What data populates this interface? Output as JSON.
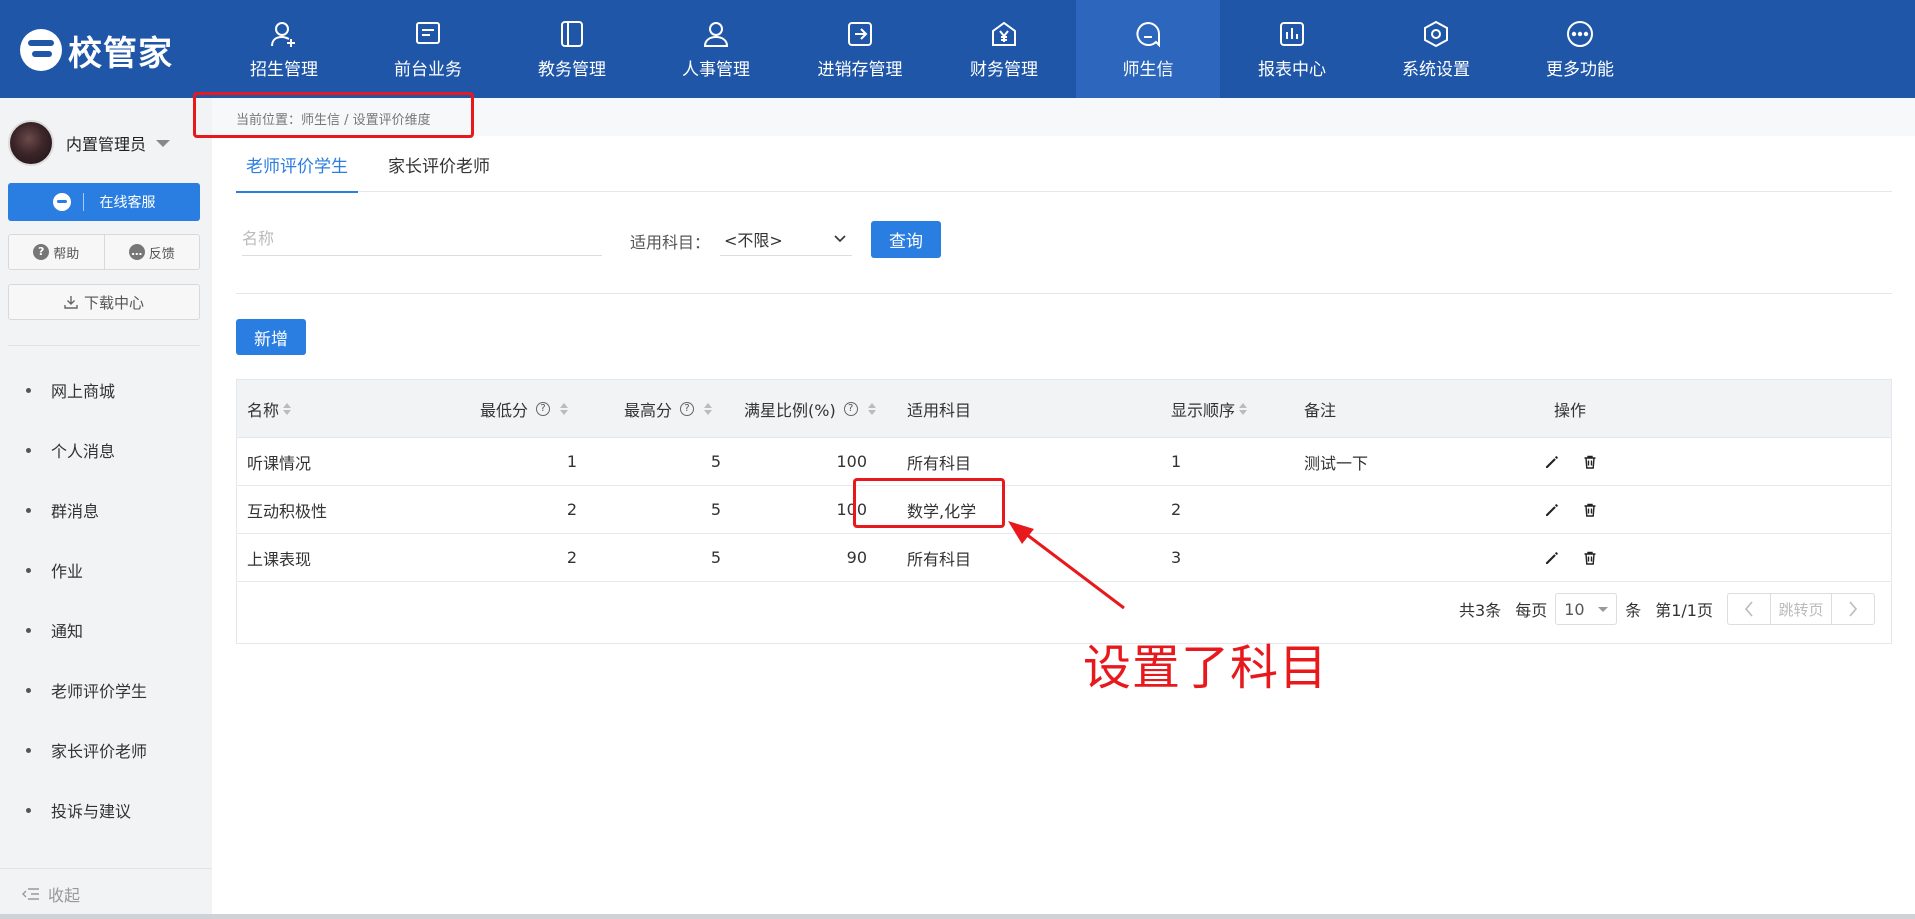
{
  "app": {
    "logo_text": "校管家"
  },
  "nav": {
    "items": [
      {
        "label": "招生管理",
        "icon": "user-plus-icon"
      },
      {
        "label": "前台业务",
        "icon": "message-box-icon"
      },
      {
        "label": "教务管理",
        "icon": "book-icon"
      },
      {
        "label": "人事管理",
        "icon": "person-icon"
      },
      {
        "label": "进销存管理",
        "icon": "arrow-box-icon"
      },
      {
        "label": "财务管理",
        "icon": "yen-house-icon"
      },
      {
        "label": "师生信",
        "icon": "chat-bubble-icon",
        "active": true
      },
      {
        "label": "报表中心",
        "icon": "bar-chart-icon"
      },
      {
        "label": "系统设置",
        "icon": "hexagon-gear-icon"
      },
      {
        "label": "更多功能",
        "icon": "more-dots-icon"
      }
    ]
  },
  "sidebar": {
    "user_name": "内置管理员",
    "service_label": "在线客服",
    "help_label": "帮助",
    "feedback_label": "反馈",
    "download_label": "下载中心",
    "menu": [
      "网上商城",
      "个人消息",
      "群消息",
      "作业",
      "通知",
      "老师评价学生",
      "家长评价老师",
      "投诉与建议"
    ],
    "collapse_label": "收起"
  },
  "breadcrumb": "当前位置：师生信 / 设置评价维度",
  "tabs": [
    {
      "label": "老师评价学生",
      "active": true
    },
    {
      "label": "家长评价老师",
      "active": false
    }
  ],
  "filter": {
    "name_placeholder": "名称",
    "subject_label": "适用科目：",
    "subject_value": "<不限>",
    "query_label": "查询"
  },
  "add_label": "新增",
  "table": {
    "headers": {
      "name": "名称",
      "min": "最低分",
      "max": "最高分",
      "ratio": "满星比例(%)",
      "subject": "适用科目",
      "order": "显示顺序",
      "note": "备注",
      "action": "操作"
    },
    "rows": [
      {
        "name": "听课情况",
        "min": "1",
        "max": "5",
        "ratio": "100",
        "subject": "所有科目",
        "order": "1",
        "note": "测试一下"
      },
      {
        "name": "互动积极性",
        "min": "2",
        "max": "5",
        "ratio": "100",
        "subject": "数学,化学",
        "order": "2",
        "note": ""
      },
      {
        "name": "上课表现",
        "min": "2",
        "max": "5",
        "ratio": "90",
        "subject": "所有科目",
        "order": "3",
        "note": ""
      }
    ]
  },
  "pager": {
    "total": "共3条",
    "per_page_label": "每页",
    "per_page_value": "10",
    "unit": "条",
    "page_info": "第1/1页",
    "jump_label": "跳转页"
  },
  "annotation": {
    "text": "设置了科目"
  },
  "colors": {
    "primary": "#2a7de1",
    "topbar": "#1f56a8",
    "annotation": "#e8191c"
  }
}
